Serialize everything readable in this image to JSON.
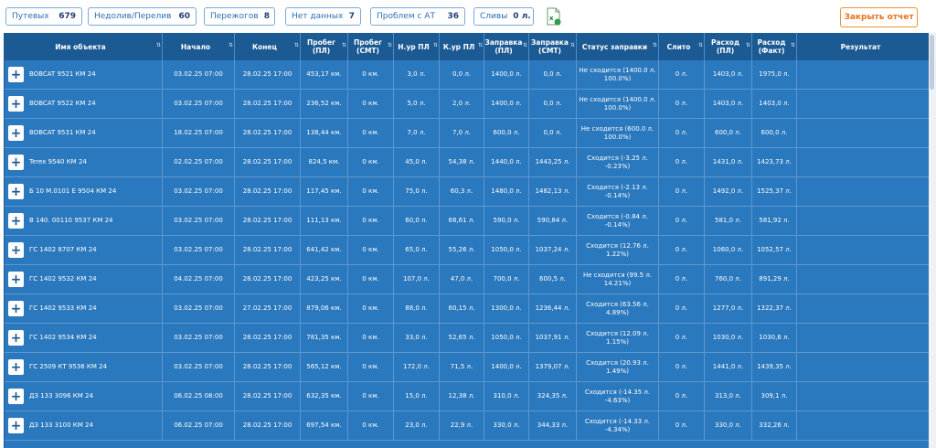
{
  "filters": [
    {
      "label": "Путевых",
      "count": "679"
    },
    {
      "label": "Недолив/Перелив",
      "count": "60"
    },
    {
      "label": "Пережогов",
      "count": "8"
    },
    {
      "label": "Нет данных",
      "count": "7"
    },
    {
      "label": "Проблем с АТ",
      "count": "36"
    },
    {
      "label": "Сливы",
      "count": "0 л."
    }
  ],
  "excel_icon": "excel-export-icon",
  "close_report_label": "Закрыть отчет",
  "columns": [
    "Имя объекта",
    "Начало",
    "Конец",
    "Пробег (ПЛ)",
    "Пробег (СМТ)",
    "Н.ур ПЛ",
    "К.ур ПЛ",
    "Заправка (ПЛ)",
    "Заправка (СМТ)",
    "Статус заправки",
    "Слито",
    "Расход (ПЛ)",
    "Расход (Факт)",
    "Результат"
  ],
  "rows": [
    [
      "BOBCAT 9521 КМ 24",
      "03.02.25 07:00",
      "28.02.25 17:00",
      "453,17 км.",
      "0 км.",
      "3,0 л.",
      "0,0 л.",
      "1400,0 л.",
      "0,0 л.",
      "Не сходится (1400.0 л. 100.0%)",
      "0 л.",
      "1403,0 л.",
      "1975,0 л.",
      ""
    ],
    [
      "BOBCAT 9522 КМ 24",
      "03.02.25 07:00",
      "28.02.25 17:00",
      "236,52 км.",
      "0 км.",
      "5,0 л.",
      "2,0 л.",
      "1400,0 л.",
      "0,0 л.",
      "Не сходится (1400.0 л. 100.0%)",
      "0 л.",
      "1403,0 л.",
      "1403,0 л.",
      ""
    ],
    [
      "BOBCAT 9531 КМ 24",
      "18.02.25 07:00",
      "28.02.25 17:00",
      "138,44 км.",
      "0 км.",
      "7,0 л.",
      "7,0 л.",
      "600,0 л.",
      "0,0 л.",
      "Не сходится (600.0 л. 100.0%)",
      "0 л.",
      "600,0 л.",
      "600,0 л.",
      ""
    ],
    [
      "Terex 9540 КМ 24",
      "02.02.25 07:00",
      "28.02.25 17:00",
      "824,5 км.",
      "0 км.",
      "45,0 л.",
      "54,38 л.",
      "1440,0 л.",
      "1443,25 л.",
      "Сходится (-3.25 л. -0.23%)",
      "0 л.",
      "1431,0 л.",
      "1423,73 л.",
      ""
    ],
    [
      "Б 10 М.0101 Е 9504 КМ 24",
      "03.02.25 07:00",
      "28.02.25 17:00",
      "117,45 км.",
      "0 км.",
      "75,0 л.",
      "60,3 л.",
      "1480,0 л.",
      "1482,13 л.",
      "Сходится (-2.13 л. -0.14%)",
      "0 л.",
      "1492,0 л.",
      "1525,37 л.",
      ""
    ],
    [
      "В 140. 00110 9537 КМ 24",
      "03.02.25 07:00",
      "28.02.25 17:00",
      "111,13 км.",
      "0 км.",
      "60,0 л.",
      "68,61 л.",
      "590,0 л.",
      "590,84 л.",
      "Сходится (-0.84 л. -0.14%)",
      "0 л.",
      "581,0 л.",
      "581,92 л.",
      ""
    ],
    [
      "ГС 1402 8707 КМ 24",
      "03.02.25 07:00",
      "28.02.25 17:00",
      "641,42 км.",
      "0 км.",
      "65,0 л.",
      "55,26 л.",
      "1050,0 л.",
      "1037,24 л.",
      "Сходится (12.76 л. 1.22%)",
      "0 л.",
      "1060,0 л.",
      "1052,57 л.",
      ""
    ],
    [
      "ГС 1402 9532 КМ 24",
      "04.02.25 07:00",
      "28.02.25 17:00",
      "423,25 км.",
      "0 км.",
      "107,0 л.",
      "47,0 л.",
      "700,0 л.",
      "600,5 л.",
      "Не сходится (99.5 л. 14.21%)",
      "0 л.",
      "760,0 л.",
      "891,29 л.",
      ""
    ],
    [
      "ГС 1402 9533 КМ 24",
      "03.02.25 07:00",
      "27.02.25 17:00",
      "879,06 км.",
      "0 км.",
      "88,0 л.",
      "60,15 л.",
      "1300,0 л.",
      "1236,44 л.",
      "Сходится (63.56 л. 4.89%)",
      "0 л.",
      "1277,0 л.",
      "1322,37 л.",
      ""
    ],
    [
      "ГС 1402 9534 КМ 24",
      "03.02.25 07:00",
      "28.02.25 17:00",
      "781,35 км.",
      "0 км.",
      "33,0 л.",
      "52,65 л.",
      "1050,0 л.",
      "1037,91 л.",
      "Сходится (12.09 л. 1.15%)",
      "0 л.",
      "1030,0 л.",
      "1030,6 л.",
      ""
    ],
    [
      "ГС 2509 КТ 9536 КМ 24",
      "03.02.25 07:00",
      "28.02.25 17:00",
      "565,12 км.",
      "0 км.",
      "172,0 л.",
      "71,5 л.",
      "1400,0 л.",
      "1379,07 л.",
      "Сходится (20.93 л. 1.49%)",
      "0 л.",
      "1441,0 л.",
      "1439,35 л.",
      ""
    ],
    [
      "ДЗ 133 3096 КМ 24",
      "06.02.25 08:00",
      "28.02.25 17:00",
      "632,35 км.",
      "0 км.",
      "15,0 л.",
      "12,38 л.",
      "310,0 л.",
      "324,35 л.",
      "Сходится (-14.35 л. -4.63%)",
      "0 л.",
      "313,0 л.",
      "309,1 л.",
      ""
    ],
    [
      "ДЗ 133 3100 КМ 24",
      "06.02.25 07:00",
      "28.02.25 17:00",
      "697,54 км.",
      "0 км.",
      "23,0 л.",
      "22,9 л.",
      "330,0 л.",
      "344,33 л.",
      "Сходится (-14.33 л. -4.34%)",
      "0 л.",
      "330,0 л.",
      "332,26 л.",
      ""
    ]
  ],
  "colors": {
    "header_bg": "#1c5a94",
    "row_bg": "#2a78bd",
    "accent_orange": "#f0902c",
    "chip_border": "#7aa8d6"
  }
}
